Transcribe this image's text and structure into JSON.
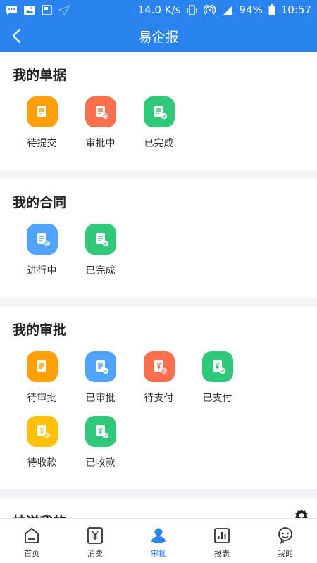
{
  "status_bar": {
    "speed": "14.0 K/s",
    "battery": "94%",
    "time": "10:57"
  },
  "header": {
    "title": "易企报"
  },
  "sections": [
    {
      "title": "我的单据",
      "items": [
        {
          "label": "待提交",
          "color": "#ff9f0a",
          "icon": "document-icon"
        },
        {
          "label": "审批中",
          "color": "#fb6f4d",
          "icon": "document-clock-icon"
        },
        {
          "label": "已完成",
          "color": "#2fc97a",
          "icon": "document-check-icon"
        }
      ]
    },
    {
      "title": "我的合同",
      "items": [
        {
          "label": "进行中",
          "color": "#4ea3fb",
          "icon": "document-clock-icon"
        },
        {
          "label": "已完成",
          "color": "#2fc97a",
          "icon": "document-check-icon"
        }
      ]
    },
    {
      "title": "我的审批",
      "items": [
        {
          "label": "待审批",
          "color": "#ff9f0a",
          "icon": "document-icon"
        },
        {
          "label": "已审批",
          "color": "#4ea3fb",
          "icon": "document-check-icon"
        },
        {
          "label": "待支付",
          "color": "#fb6f4d",
          "icon": "yuan-clock-icon"
        },
        {
          "label": "已支付",
          "color": "#2fc97a",
          "icon": "yuan-check-icon"
        },
        {
          "label": "待收款",
          "color": "#ffc107",
          "icon": "yuan-clock-icon"
        },
        {
          "label": "已收款",
          "color": "#2fc97a",
          "icon": "yuan-check-icon"
        }
      ]
    },
    {
      "title": "抄送我的",
      "items": []
    }
  ],
  "tabbar": [
    {
      "label": "首页",
      "icon": "home-icon",
      "active": false
    },
    {
      "label": "消费",
      "icon": "yuan-receipt-icon",
      "active": false
    },
    {
      "label": "审批",
      "icon": "user-approval-icon",
      "active": true
    },
    {
      "label": "报表",
      "icon": "bar-chart-icon",
      "active": false
    },
    {
      "label": "我的",
      "icon": "profile-face-icon",
      "active": false
    }
  ],
  "accent_color": "#2a84f0"
}
